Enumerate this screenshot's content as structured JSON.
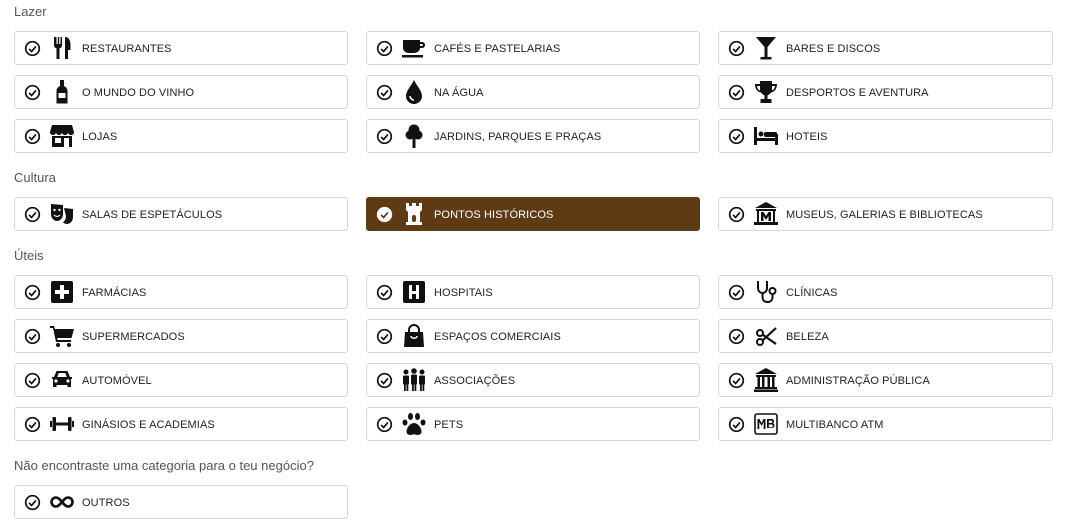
{
  "sections": {
    "lazer": "Lazer",
    "cultura": "Cultura",
    "uteis": "Úteis",
    "outros": "Não encontraste uma categoria para o teu negócio?"
  },
  "categories": {
    "restaurantes": {
      "label": "RESTAURANTES",
      "icon": "fork-knife-icon"
    },
    "cafes": {
      "label": "CAFÉS E PASTELARIAS",
      "icon": "coffee-cup-icon"
    },
    "bares": {
      "label": "BARES E DISCOS",
      "icon": "cocktail-glass-icon"
    },
    "vinho": {
      "label": "O MUNDO DO VINHO",
      "icon": "wine-bottle-icon"
    },
    "agua": {
      "label": "NA ÁGUA",
      "icon": "water-drop-icon"
    },
    "desportos": {
      "label": "DESPORTOS E AVENTURA",
      "icon": "trophy-icon"
    },
    "lojas": {
      "label": "LOJAS",
      "icon": "store-icon"
    },
    "jardins": {
      "label": "JARDINS, PARQUES E PRAÇAS",
      "icon": "tree-icon"
    },
    "hoteis": {
      "label": "HOTEIS",
      "icon": "bed-icon"
    },
    "salas": {
      "label": "SALAS DE ESPETÁCULOS",
      "icon": "theater-masks-icon"
    },
    "pontos": {
      "label": "PONTOS HISTÓRICOS",
      "icon": "castle-tower-icon",
      "selected": true
    },
    "museus": {
      "label": "MUSEUS, GALERIAS E BIBLIOTECAS",
      "icon": "museum-icon"
    },
    "farmacias": {
      "label": "FARMÁCIAS",
      "icon": "pharmacy-cross-icon"
    },
    "hospitais": {
      "label": "HOSPITAIS",
      "icon": "hospital-icon"
    },
    "clinicas": {
      "label": "CLÍNICAS",
      "icon": "stethoscope-icon"
    },
    "supermercados": {
      "label": "SUPERMERCADOS",
      "icon": "shopping-cart-icon"
    },
    "espacos": {
      "label": "ESPAÇOS COMERCIAIS",
      "icon": "shopping-bag-icon"
    },
    "beleza": {
      "label": "BELEZA",
      "icon": "scissors-icon"
    },
    "automovel": {
      "label": "AUTOMÓVEL",
      "icon": "car-icon"
    },
    "associacoes": {
      "label": "ASSOCIAÇÕES",
      "icon": "people-group-icon"
    },
    "administracao": {
      "label": "ADMINISTRAÇÃO PÚBLICA",
      "icon": "government-building-icon"
    },
    "ginasios": {
      "label": "GINÁSIOS E ACADEMIAS",
      "icon": "dumbbell-icon"
    },
    "pets": {
      "label": "PETS",
      "icon": "paw-icon"
    },
    "multibanco": {
      "label": "MULTIBANCO ATM",
      "icon": "multibanco-icon"
    },
    "outros": {
      "label": "OUTROS",
      "icon": "infinity-icon"
    }
  },
  "colors": {
    "selected_bg": "#5f3b15",
    "border": "#d6d6d6"
  }
}
